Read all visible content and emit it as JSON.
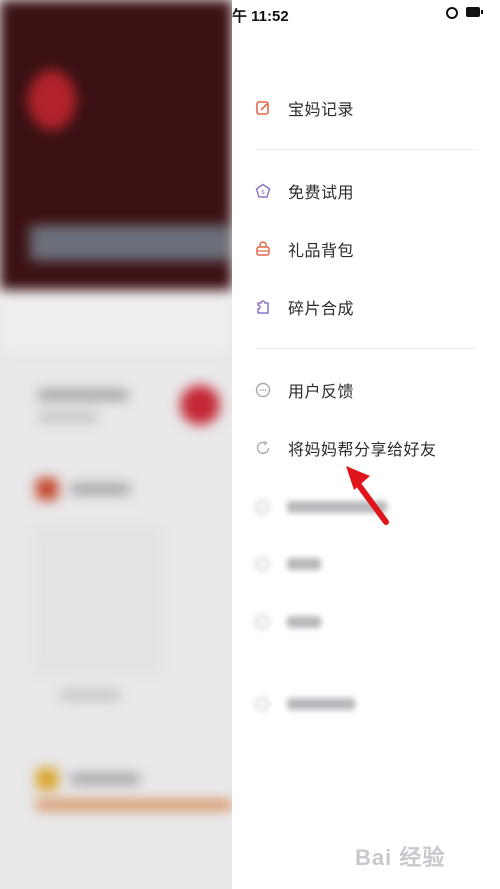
{
  "status_bar": {
    "time": "午 11:52"
  },
  "menu": {
    "section1": [
      {
        "label": "宝妈记录",
        "icon": "edit-icon",
        "color": "#e06a4a"
      }
    ],
    "section2": [
      {
        "label": "免费试用",
        "icon": "trial-icon",
        "color": "#8d77c9"
      },
      {
        "label": "礼品背包",
        "icon": "gift-bag-icon",
        "color": "#e06a4a"
      },
      {
        "label": "碎片合成",
        "icon": "puzzle-icon",
        "color": "#8d77c9"
      }
    ],
    "section3": [
      {
        "label": "用户反馈",
        "icon": "feedback-icon",
        "color": "#aaaaaa"
      },
      {
        "label": "将妈妈帮分享给好友",
        "icon": "share-icon",
        "color": "#aaaaaa"
      }
    ]
  },
  "watermark": "Bai 经验",
  "colors": {
    "accent_red": "#c42735",
    "arrow": "#e0151c"
  }
}
